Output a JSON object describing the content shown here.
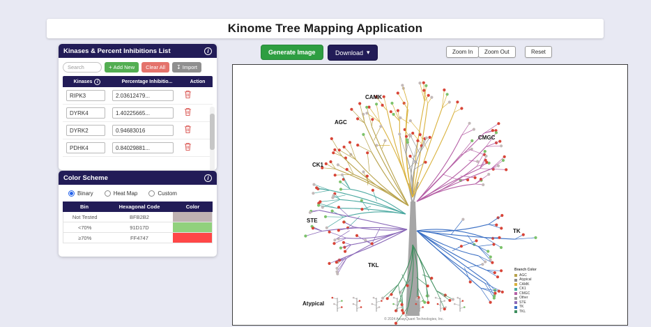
{
  "app": {
    "title": "Kinome Tree Mapping Application"
  },
  "theme": {
    "navy": "#221c57",
    "green_button": "#2e9e41",
    "add_green": "#53ae52",
    "clear_red": "#e4736c",
    "import_gray": "#8f8f8f",
    "page_bg": "#e8e9f3"
  },
  "icons": {
    "caret_down": "▾",
    "info": "i",
    "scroll_down": "▼"
  },
  "toolbar": {
    "generate_label": "Generate Image",
    "download_label": "Download",
    "zoom_in_label": "Zoom In",
    "zoom_out_label": "Zoom Out",
    "reset_label": "Reset"
  },
  "kinase_panel": {
    "title": "Kinases & Percent Inhibitions List",
    "search_placeholder": "Search",
    "add_label": "Add New",
    "clear_label": "Clear All",
    "import_label": "Import",
    "columns": [
      "Kinases",
      "Percentage Inhibitio...",
      "Action"
    ],
    "rows": [
      {
        "kinase": "RIPK3",
        "value": "2.03612479..."
      },
      {
        "kinase": "DYRK4",
        "value": "1.40225665..."
      },
      {
        "kinase": "DYRK2",
        "value": "0.94683016"
      },
      {
        "kinase": "PDHK4",
        "value": "0.84029881..."
      }
    ]
  },
  "color_scheme": {
    "title": "Color Scheme",
    "options": [
      "Binary",
      "Heat Map",
      "Custom"
    ],
    "selected": "Binary",
    "columns": [
      "Bin",
      "Hexagonal Code",
      "Color"
    ],
    "rows": [
      {
        "bin": "Not Tested",
        "hex": "BFB2B2",
        "color": "#BFB2B2"
      },
      {
        "bin": "<70%",
        "hex": "91D17D",
        "color": "#91D17D"
      },
      {
        "bin": "≥70%",
        "hex": "FF4747",
        "color": "#FF4747"
      }
    ]
  },
  "tree": {
    "labels": [
      "CAMK",
      "AGC",
      "CMGC",
      "CK1",
      "STE",
      "TK",
      "TKL",
      "Atypical"
    ],
    "legend_title": "Branch Color",
    "legend": [
      {
        "name": "AGC",
        "color": "#b8a24a"
      },
      {
        "name": "Atypical",
        "color": "#8c8c8c"
      },
      {
        "name": "CAMK",
        "color": "#d9b13b"
      },
      {
        "name": "CK1",
        "color": "#4aa8a0"
      },
      {
        "name": "CMGC",
        "color": "#b55fa5"
      },
      {
        "name": "Other",
        "color": "#999999"
      },
      {
        "name": "STE",
        "color": "#8a68b8"
      },
      {
        "name": "TK",
        "color": "#3a6fc4"
      },
      {
        "name": "TKL",
        "color": "#3f8f5f"
      }
    ],
    "tip_colors": {
      "red": "#d84437",
      "green": "#7cc26b",
      "not_tested": "#c3b9b9"
    },
    "copyright": "© 2024 AssayQuant Technologies, Inc."
  }
}
